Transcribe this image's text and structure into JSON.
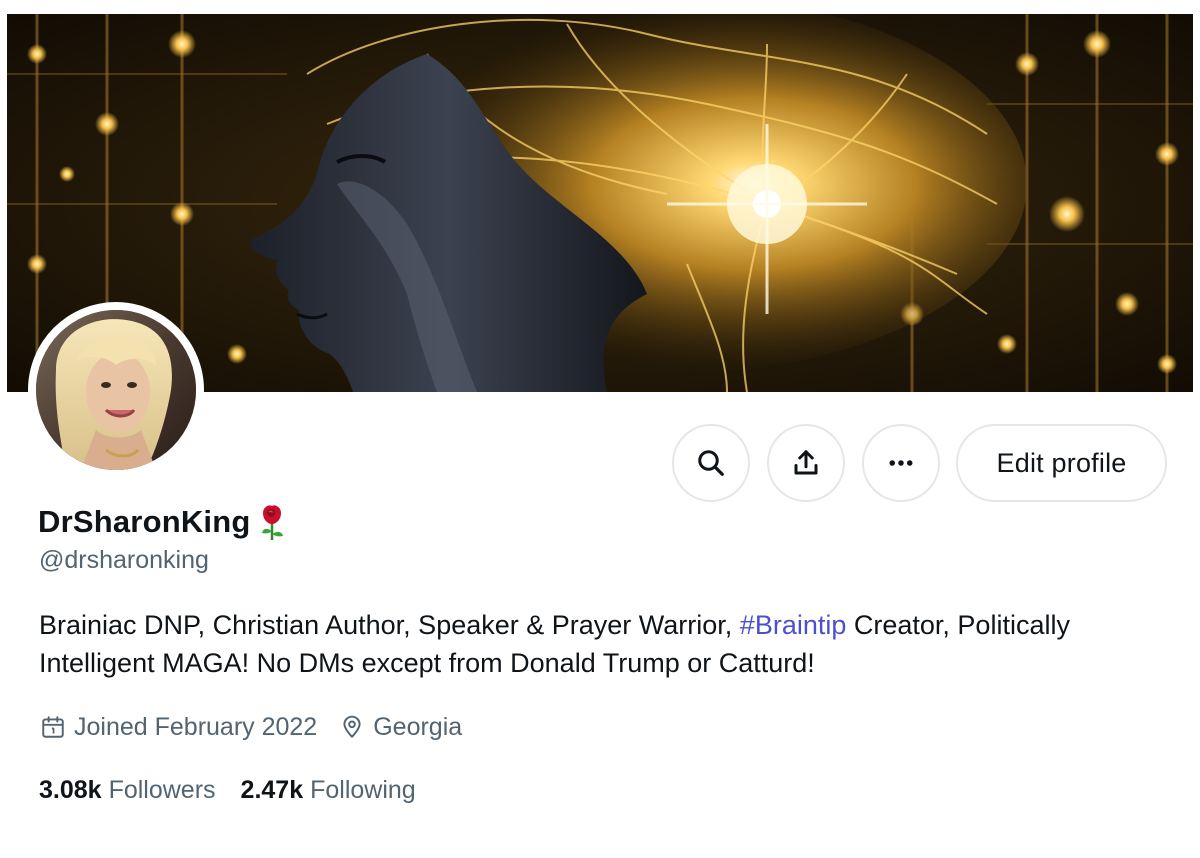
{
  "profile": {
    "display_name": "DrSharonKing",
    "handle": "@drsharonking",
    "bio_part1": "Brainiac DNP, Christian Author, Speaker & Prayer Warrior, ",
    "bio_hashtag": "#Braintip",
    "bio_part2": " Creator, Politically Intelligent MAGA! No DMs except from Donald Trump or Catturd!",
    "joined": "Joined February 2022",
    "location": "Georgia",
    "followers_count": "3.08k",
    "followers_label": "Followers",
    "following_count": "2.47k",
    "following_label": "Following"
  },
  "actions": {
    "edit_profile_label": "Edit profile",
    "search_icon": "search-icon",
    "share_icon": "share-icon",
    "more_icon": "more-icon"
  },
  "icons": {
    "name_emoji": "rose-icon",
    "joined": "calendar-icon",
    "location": "location-pin-icon"
  },
  "colors": {
    "text_primary": "#0f1419",
    "text_secondary": "#536471",
    "hashtag": "#4d4fd1",
    "button_border": "#e4e6ea",
    "rose": "#c8102e"
  }
}
